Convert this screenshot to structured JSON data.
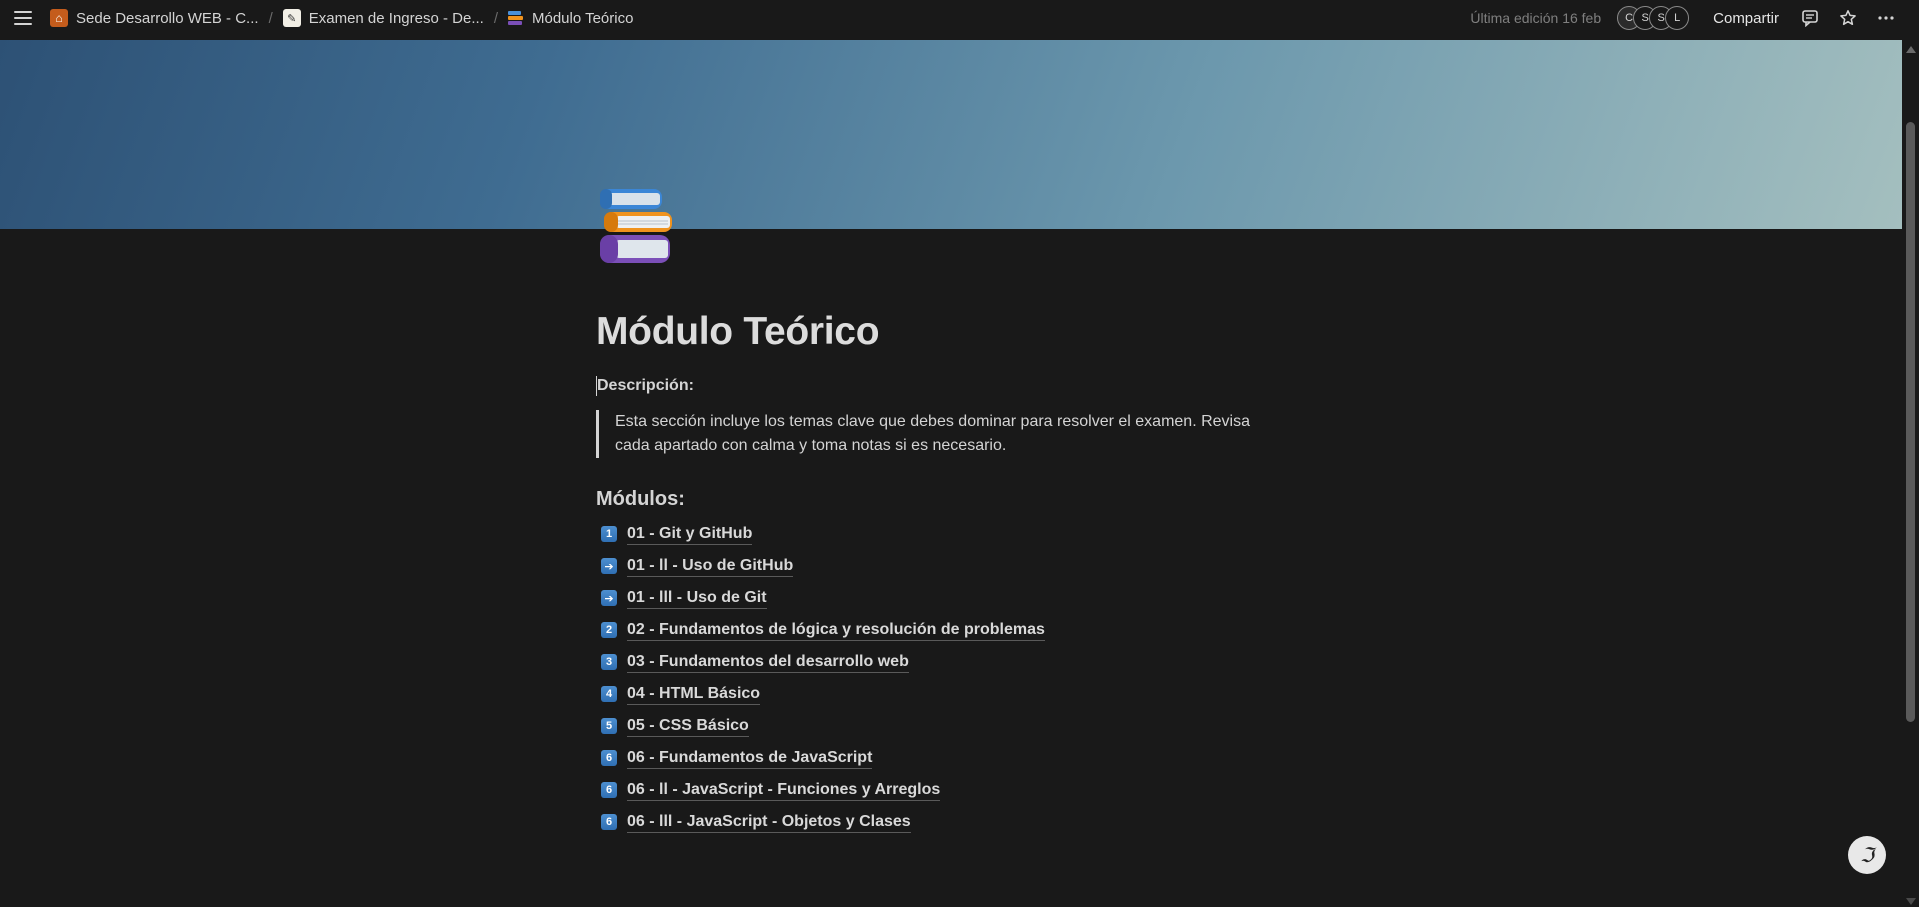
{
  "topbar": {
    "breadcrumbs": [
      {
        "label": "Sede Desarrollo WEB - C...",
        "icon": "house-icon"
      },
      {
        "label": "Examen de Ingreso - De...",
        "icon": "memo-icon"
      },
      {
        "label": "Módulo Teórico",
        "icon": "books-icon"
      }
    ],
    "separator": "/",
    "last_edited": "Última edición 16 feb",
    "avatars": [
      "C",
      "S",
      "S",
      "L"
    ],
    "share_label": "Compartir"
  },
  "page": {
    "title": "Módulo Teórico",
    "description_label": "Descripción:",
    "description_text": "Esta sección incluye los temas clave que debes dominar para resolver el examen. Revisa cada apartado con calma y toma notas si es necesario.",
    "modules_heading": "Módulos:",
    "modules": [
      {
        "badge": "1",
        "label": "01 - Git y GitHub"
      },
      {
        "badge": "➔",
        "label": "01 - ll - Uso de GitHub"
      },
      {
        "badge": "➔",
        "label": "01 - lll - Uso de Git"
      },
      {
        "badge": "2",
        "label": "02 - Fundamentos de lógica y resolución de problemas"
      },
      {
        "badge": "3",
        "label": "03 - Fundamentos del desarrollo web"
      },
      {
        "badge": "4",
        "label": "04 - HTML Básico"
      },
      {
        "badge": "5",
        "label": "05 - CSS Básico"
      },
      {
        "badge": "6",
        "label": "06 - Fundamentos de JavaScript"
      },
      {
        "badge": "6",
        "label": "06 - ll - JavaScript - Funciones y Arreglos"
      },
      {
        "badge": "6",
        "label": "06 - lll - JavaScript - Objetos y Clases"
      }
    ]
  },
  "help_button_glyph": "ℑ",
  "colors": {
    "background": "#191919",
    "cover_start": "#2d5175",
    "cover_end": "#a4bfbf",
    "keycap": "#3a7cc0"
  }
}
